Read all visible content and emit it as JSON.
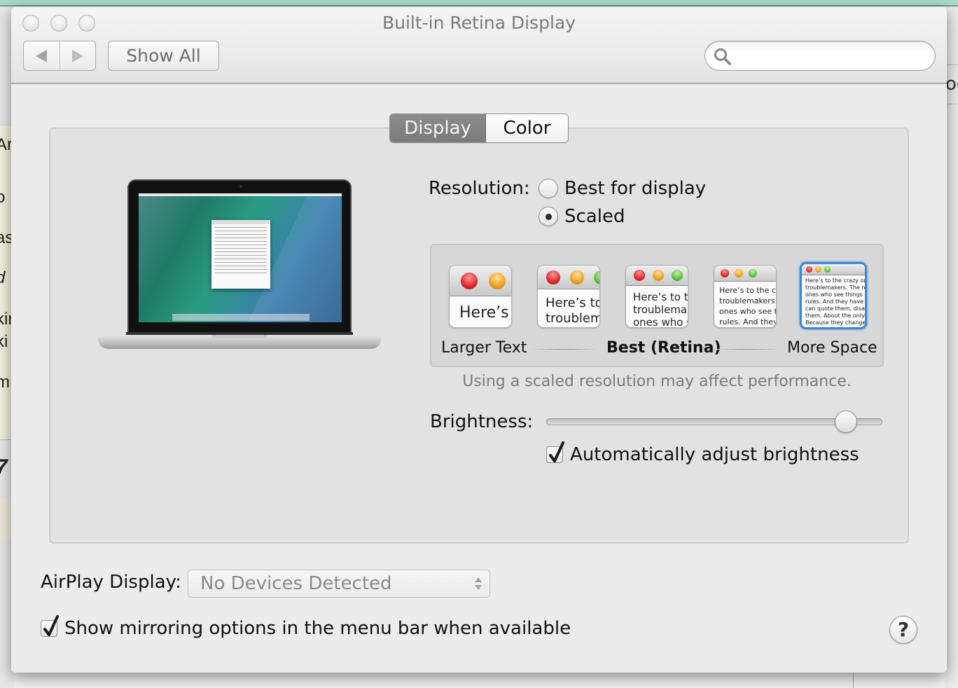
{
  "window": {
    "title": "Built-in Retina Display",
    "back_icon": "triangle-left",
    "forward_icon": "triangle-right",
    "show_all_label": "Show All",
    "search": {
      "value": "",
      "placeholder": "",
      "icon": "magnifier"
    }
  },
  "tabs": [
    {
      "label": "Display",
      "active": true
    },
    {
      "label": "Color",
      "active": false
    }
  ],
  "resolution": {
    "label": "Resolution:",
    "options": [
      {
        "label": "Best for display",
        "selected": false
      },
      {
        "label": "Scaled",
        "selected": true
      }
    ],
    "scale_options": [
      {
        "preview_text": "Here’s",
        "selected": false
      },
      {
        "preview_text": "Here’s to\ntroublem",
        "selected": false
      },
      {
        "preview_text": "Here’s to th\ntroublemak\nones who s",
        "selected": false
      },
      {
        "preview_text": "Here’s to the cr\ntroublemakers.\nones who see t\nrules. And they",
        "selected": false
      },
      {
        "preview_text": "Here’s to the crazy ones\ntroublemakers. The rou\nones who see things di\nrules. And they have no\ncan quote them, disagr\nthem. About the only th\nBecause they change th",
        "selected": true
      }
    ],
    "scale_labels": {
      "left": "Larger Text",
      "center": "Best (Retina)",
      "right": "More Space"
    },
    "note": "Using a scaled resolution may affect performance."
  },
  "brightness": {
    "label": "Brightness:",
    "value": 0.92,
    "auto_adjust": {
      "label": "Automatically adjust brightness",
      "checked": true
    }
  },
  "airplay": {
    "label": "AirPlay Display:",
    "selected": "No Devices Detected"
  },
  "mirroring": {
    "label": "Show mirroring options in the menu bar when available",
    "checked": true
  },
  "help_label": "?",
  "background_fragments": {
    "left": [
      "Ar",
      "o",
      "as",
      "d",
      "kir",
      "ki",
      "m",
      "7"
    ],
    "right": "og"
  },
  "colors": {
    "selection_blue": "#3f88d8",
    "tab_active": "#808080"
  }
}
